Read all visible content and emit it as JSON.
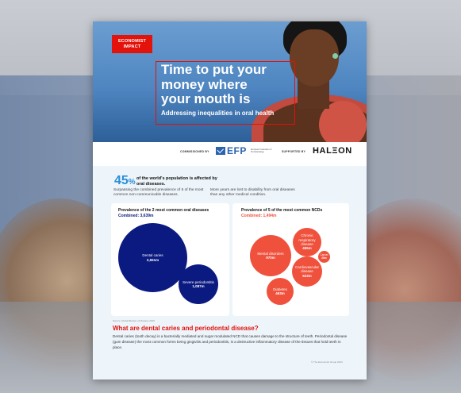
{
  "cover": {
    "brand_line1": "ECONOMIST",
    "brand_line2": "IMPACT",
    "title_line1": "Time to put your",
    "title_line2": "money where",
    "title_line3": "your mouth is",
    "subtitle": "Addressing inequalities in oral health"
  },
  "sponsors": {
    "commissioned_label": "COMMISSIONED BY",
    "efp_name": "EFP",
    "efp_full": "European Federation of Periodontology",
    "supported_label": "SUPPORTED BY",
    "haleon_name": "HALΞON"
  },
  "stats": {
    "headline_number": "45",
    "headline_unit": "%",
    "headline_text": "of the world's population is affected by oral diseases.",
    "left_text": "Surpassing the combined prevalence of 5 of the most common non-communicable diseases.",
    "right_text": "More years are lost to disability from oral diseases than any other medical condition."
  },
  "oral_panel": {
    "title": "Prevalence of the 2 most common oral diseases",
    "combined": "Combined: 3,639m",
    "color": "#0b1a80",
    "bubbles": [
      {
        "label": "Dental caries",
        "value": "2,551m"
      },
      {
        "label": "Severe periodontitis",
        "value": "1,087m"
      }
    ]
  },
  "ncd_panel": {
    "title": "Prevalence of 5 of the most common NCDs",
    "combined": "Combined: 1,494m",
    "color": "#f0513c",
    "bubbles": [
      {
        "label": "Mental disorders",
        "value": "970m"
      },
      {
        "label_line1": "Chronic",
        "label_line2": "respiratory",
        "label_line3": "disease",
        "value": "455m"
      },
      {
        "label": "Cancer",
        "value": "26m"
      },
      {
        "label_line1": "Cardiovascular",
        "label_line2": "disease",
        "value": "523m"
      },
      {
        "label": "Diabetes",
        "value": "463m"
      }
    ]
  },
  "footer": {
    "source": "Source: Global Burden of Disease 2019",
    "question": "What are dental caries and periodontal disease?",
    "answer": "Dental caries (tooth decay) is a bacterially mediated and sugar modulated NCD that causes damage to the structure of teeth. Periodontal disease (gum disease) the most common forms being gingivitis and periodontitis, is a destructive inflammatory disease of the tissues that hold teeth in place.",
    "copyright": "© The Economist Group 2024"
  }
}
